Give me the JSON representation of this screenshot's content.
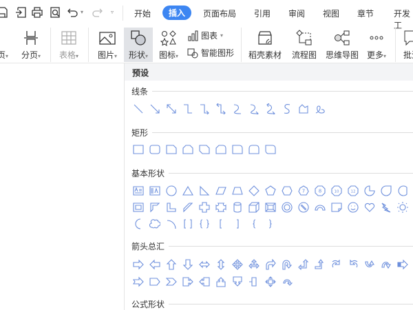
{
  "quick_access": {
    "icons": [
      "save-icon",
      "export-icon",
      "print-icon",
      "print-preview-icon",
      "undo-icon",
      "redo-icon",
      "customize-icon"
    ]
  },
  "tabs": [
    {
      "label": "开始"
    },
    {
      "label": "插入",
      "active": true
    },
    {
      "label": "页面布局"
    },
    {
      "label": "引用"
    },
    {
      "label": "审阅"
    },
    {
      "label": "视图"
    },
    {
      "label": "章节"
    },
    {
      "label": "开发工"
    }
  ],
  "ribbon": {
    "page": "页",
    "page_break": "分页",
    "table": "表格",
    "picture": "图片",
    "shape": "形状",
    "icon": "图标",
    "chart": "图表",
    "smart_art": "智能图形",
    "docer": "稻壳素材",
    "flowchart": "流程图",
    "mindmap": "思维导图",
    "more": "更多",
    "comment": "批注"
  },
  "shapes_panel": {
    "header": "预设",
    "sections": [
      {
        "title": "线条",
        "rows": [
          [
            "line",
            "arrow",
            "double-arrow",
            "elbow",
            "elbow-arrow",
            "elbow-double-arrow",
            "curve",
            "curve-arrow",
            "curve-double-arrow",
            "s-curve",
            "freeform",
            "scribble"
          ]
        ]
      },
      {
        "title": "矩形",
        "rows": [
          [
            "rect",
            "rounded-rect",
            "snip-one",
            "snip-same",
            "snip-diag",
            "snip-round",
            "round-one",
            "round-same",
            "round-diag"
          ]
        ]
      },
      {
        "title": "基本形状",
        "rows": [
          [
            "text-box",
            "vertical-text-box",
            "ellipse",
            "triangle",
            "right-triangle",
            "parallelogram",
            "trapezoid",
            "diamond",
            "pentagon",
            "hexagon",
            "heptagon-7",
            "octagon-8",
            "decagon-10",
            "dodecagon-12",
            "pie",
            "teardrop",
            "chord"
          ],
          [
            "frame",
            "half-frame",
            "l-shape",
            "diagonal-stripe",
            "cross",
            "plaque",
            "can",
            "cube",
            "bevel",
            "donut",
            "no-symbol",
            "block-arc",
            "folded-corner",
            "smiley",
            "heart",
            "lightning",
            "sun"
          ],
          [
            "moon",
            "cloud",
            "arc",
            "double-bracket",
            "double-brace",
            "left-bracket",
            "right-bracket",
            "left-brace",
            "right-brace"
          ]
        ]
      },
      {
        "title": "箭头总汇",
        "rows": [
          [
            "right-arrow",
            "left-arrow",
            "up-arrow",
            "down-arrow",
            "left-right-arrow",
            "up-down-arrow",
            "quad-arrow",
            "left-right-up-arrow",
            "bent-arrow",
            "u-turn-arrow",
            "left-up-arrow",
            "bent-up-arrow",
            "curved-right-arrow",
            "curved-left-arrow",
            "curved-up-arrow",
            "curved-down-arrow",
            "striped-right-arrow"
          ],
          [
            "notched-right-arrow",
            "pentagon-arrow",
            "chevron",
            "right-arrow-callout",
            "left-arrow-callout",
            "up-arrow-callout",
            "down-arrow-callout",
            "left-right-arrow-callout",
            "quad-arrow-callout",
            "circular-arrow"
          ]
        ]
      },
      {
        "title": "公式形状",
        "rows": []
      }
    ]
  },
  "colors": {
    "accent": "#3d86f2",
    "shape_stroke": "#6d8fdc"
  }
}
